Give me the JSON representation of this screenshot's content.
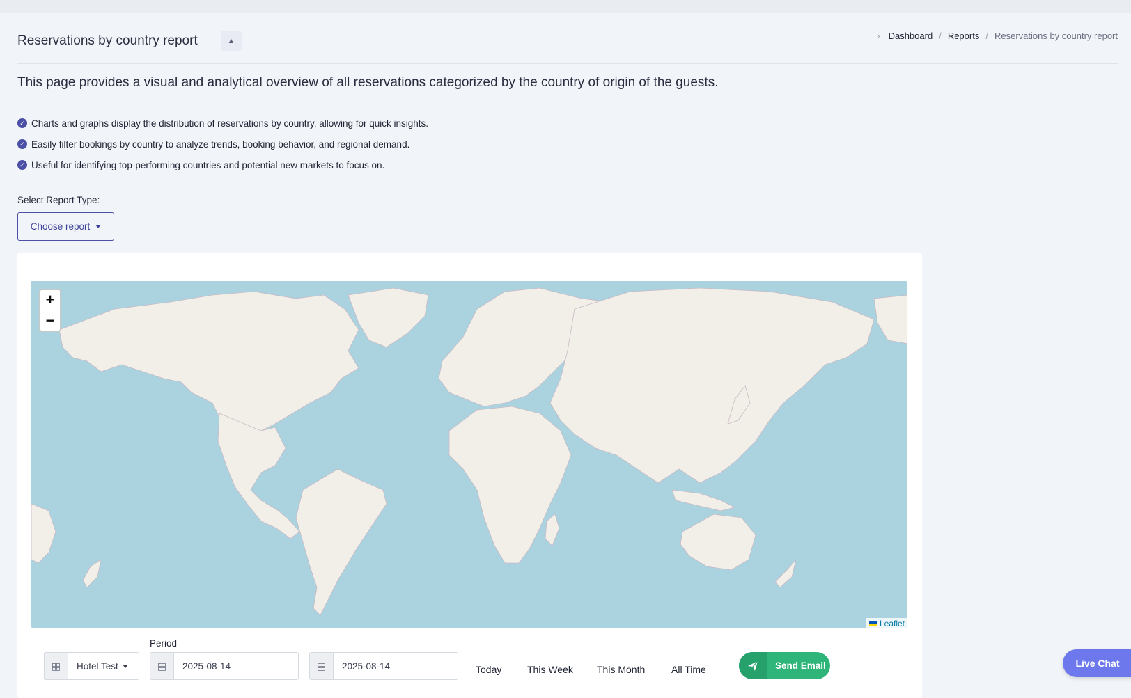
{
  "header": {
    "title": "Reservations by country report",
    "collapse_symbol": "▲",
    "breadcrumb": {
      "items": [
        "Dashboard",
        "Reports"
      ],
      "current": "Reservations by country report",
      "separator": "/"
    }
  },
  "intro": {
    "text": "This page provides a visual and analytical overview of all reservations categorized by the country of origin of the guests.",
    "bullets": [
      "Charts and graphs display the distribution of reservations by country, allowing for quick insights.",
      "Easily filter bookings by country to analyze trends, booking behavior, and regional demand.",
      "Useful for identifying top-performing countries and potential new markets to focus on."
    ]
  },
  "report_select": {
    "label": "Select Report Type:",
    "button_label": "Choose report"
  },
  "map": {
    "zoom_in": "+",
    "zoom_out": "−",
    "attribution": "Leaflet",
    "ocean_color": "#aad3df",
    "land_color": "#f2efe9"
  },
  "filters": {
    "hotel": "Hotel Test",
    "period_label": "Period",
    "date_from": "2025-08-14",
    "date_to": "2025-08-14",
    "quick_ranges": [
      "Today",
      "This Week",
      "This Month",
      "All Time"
    ],
    "send_email": "Send Email"
  },
  "live_chat": "Live Chat",
  "colors": {
    "primary": "#4b4fa6",
    "success": "#2fb57a",
    "chat": "#6c78ec"
  }
}
